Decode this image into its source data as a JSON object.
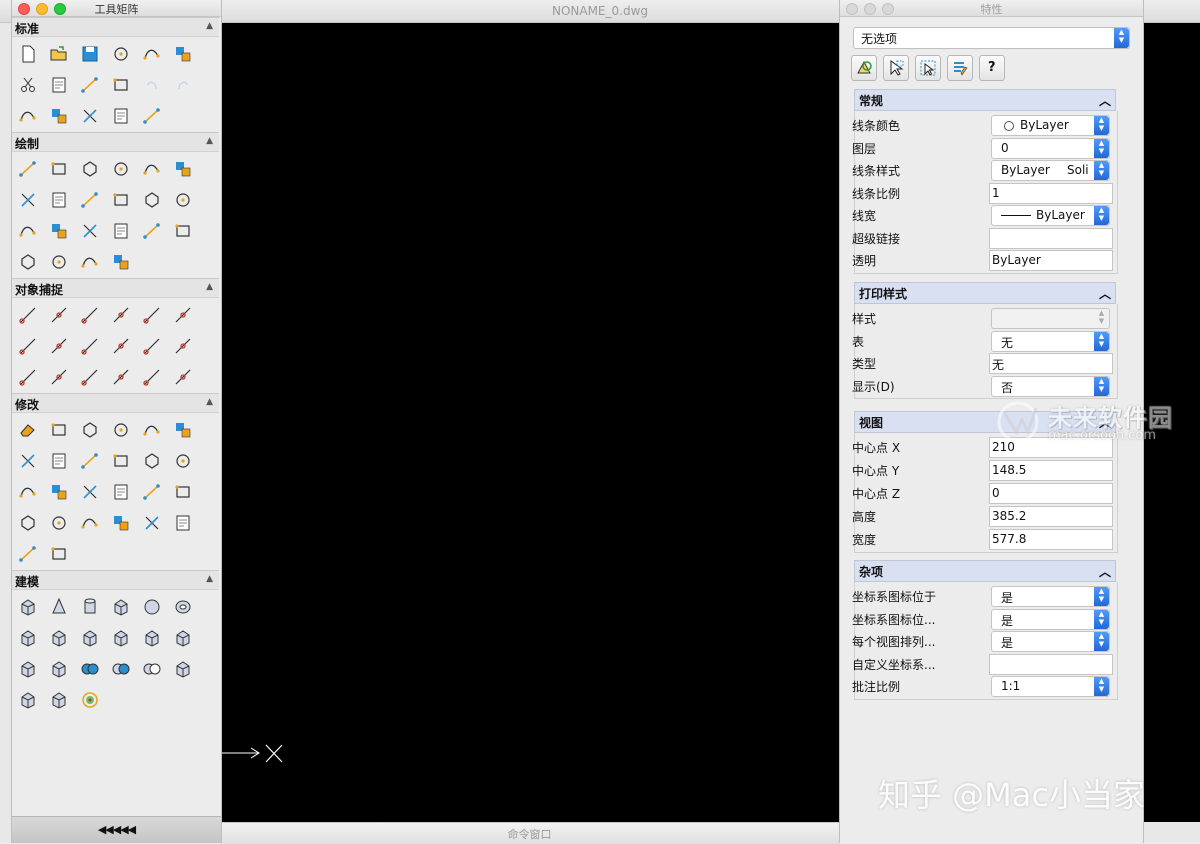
{
  "main_window": {
    "title": "NONAME_0.dwg",
    "command_bar": "命令窗口"
  },
  "tool_palette": {
    "title": "工具矩阵",
    "footer": "◀◀◀◀◀",
    "sections": [
      {
        "label": "标准",
        "icons": [
          "new-file-icon",
          "open-folder-icon",
          "save-icon",
          "print-icon",
          "plot-icon",
          "print-preview-icon",
          "cut-icon",
          "copy-icon",
          "paste-icon",
          "match-properties-icon",
          "undo-icon",
          "redo-icon",
          "pan-icon",
          "zoom-window-icon",
          "zoom-realtime-icon",
          "text-style-icon",
          "design-center-icon"
        ]
      },
      {
        "label": "绘制",
        "icons": [
          "line-icon",
          "ray-icon",
          "polygon-icon",
          "rectangle-icon",
          "polyline-icon",
          "spline-icon",
          "circle-icon",
          "arc-icon",
          "donut-icon",
          "point-grid-icon",
          "spline-fit-icon",
          "stairs-icon",
          "table-icon",
          "hatch-icon",
          "mtext-icon",
          "region-icon",
          "text-icon",
          "attribute-icon",
          "revcloud-icon",
          "boundary-icon",
          "cloud-icon",
          "wipeout-icon"
        ]
      },
      {
        "label": "对象捕捉",
        "icons": [
          "snap-endpoint-icon",
          "snap-midpoint-icon",
          "snap-intersection-icon",
          "snap-apparent-intersection-icon",
          "snap-extension-icon",
          "snap-from-icon",
          "snap-tangent-line-icon",
          "snap-center-icon",
          "snap-node-icon",
          "snap-quadrant-icon",
          "snap-tangent-icon",
          "snap-insert-icon",
          "snap-perpendicular-icon",
          "snap-parallel-icon",
          "snap-nearest-icon",
          "snap-none-icon",
          "snap-clear-icon",
          "snap-settings-icon"
        ]
      },
      {
        "label": "修改",
        "icons": [
          "erase-icon",
          "properties-delete-icon",
          "move-icon",
          "mirror-icon",
          "offset-icon",
          "fillet-edit-icon",
          "array-icon",
          "rotate-icon",
          "scale-icon",
          "stretch-icon",
          "align-icon",
          "fillet-icon",
          "lengthen-icon",
          "chamfer-icon",
          "trim-icon",
          "break-icon",
          "extend-icon",
          "explode-icon",
          "join-icon",
          "split-icon",
          "edit-block-icon",
          "copy-array-icon",
          "edit-curve-icon",
          "rotate3d-icon",
          "block-icon",
          "attribute-edit-icon"
        ]
      },
      {
        "label": "建模",
        "icons": [
          "box-icon",
          "cone-icon",
          "cylinder-icon",
          "pyramid-icon",
          "sphere-icon",
          "torus-icon",
          "wedge-icon",
          "planar-surface-icon",
          "extrude-icon",
          "loft-icon",
          "presspull-icon",
          "sweep-3d-icon",
          "revolve-icon",
          "sweep-icon",
          "union-icon",
          "subtract-icon",
          "intersect-icon",
          "section-icon",
          "slice-icon",
          "solid-edit-icon",
          "render-icon"
        ]
      }
    ]
  },
  "properties": {
    "title": "特性",
    "selection": "无选项",
    "toolbar": [
      "quick-select-icon",
      "select-objects-icon",
      "toggle-pickadd-icon",
      "properties-list-icon",
      "help-icon"
    ],
    "help_label": "?",
    "groups": [
      {
        "title": "常规",
        "rows": [
          {
            "label": "线条颜色",
            "value": "ByLayer",
            "kind": "color-select"
          },
          {
            "label": "图层",
            "value": "0",
            "kind": "select"
          },
          {
            "label": "线条样式",
            "value": "ByLayer",
            "value2": "Soli",
            "kind": "linetype-select"
          },
          {
            "label": "线条比例",
            "value": "1",
            "kind": "field"
          },
          {
            "label": "线宽",
            "value": "ByLayer",
            "kind": "lineweight-select"
          },
          {
            "label": "超级链接",
            "value": "",
            "kind": "field"
          },
          {
            "label": "透明",
            "value": "ByLayer",
            "kind": "field"
          }
        ]
      },
      {
        "title": "打印样式",
        "rows": [
          {
            "label": "样式",
            "value": "",
            "kind": "disabled-select"
          },
          {
            "label": "表",
            "value": "无",
            "kind": "select"
          },
          {
            "label": "类型",
            "value": "无",
            "kind": "field"
          },
          {
            "label": "显示(D)",
            "value": "否",
            "kind": "select"
          }
        ]
      },
      {
        "title": "视图",
        "rows": [
          {
            "label": "中心点 X",
            "value": "210",
            "kind": "field"
          },
          {
            "label": "中心点 Y",
            "value": "148.5",
            "kind": "field"
          },
          {
            "label": "中心点 Z",
            "value": "0",
            "kind": "field"
          },
          {
            "label": "高度",
            "value": "385.2",
            "kind": "field"
          },
          {
            "label": "宽度",
            "value": "577.8",
            "kind": "field"
          }
        ]
      },
      {
        "title": "杂项",
        "rows": [
          {
            "label": "坐标系图标位于",
            "value": "是",
            "kind": "select"
          },
          {
            "label": "坐标系图标位...",
            "value": "是",
            "kind": "select"
          },
          {
            "label": "每个视图排列...",
            "value": "是",
            "kind": "select"
          },
          {
            "label": "自定义坐标系...",
            "value": "",
            "kind": "field"
          },
          {
            "label": "批注比例",
            "value": "1:1",
            "kind": "select"
          }
        ]
      }
    ]
  },
  "watermarks": {
    "site_name": "未来软件园",
    "site_url": "mac.orsoon.com",
    "author": "知乎 @Mac小当家"
  },
  "colors": {
    "canvas": "#000000",
    "group_header": "#d9e0f2",
    "stepper_blue": "#2f74e0",
    "accent_orange": "#e8a21c",
    "accent_blue": "#2a8fd1"
  }
}
